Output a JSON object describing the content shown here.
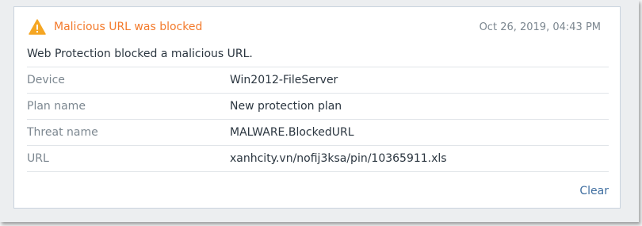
{
  "alert": {
    "title": "Malicious URL was blocked",
    "timestamp": "Oct 26, 2019, 04:43 PM",
    "message": "Web Protection blocked a malicious URL.",
    "icon": "warning-triangle-icon",
    "accent_color": "#f37a2b",
    "details": [
      {
        "label": "Device",
        "value": "Win2012-FileServer"
      },
      {
        "label": "Plan name",
        "value": "New protection plan"
      },
      {
        "label": "Threat name",
        "value": "MALWARE.BlockedURL"
      },
      {
        "label": "URL",
        "value": "xanhcity.vn/nofij3ksa/pin/10365911.xls"
      }
    ],
    "clear_label": "Clear"
  }
}
